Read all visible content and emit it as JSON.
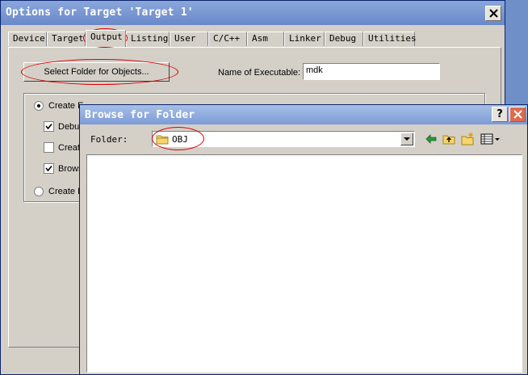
{
  "window": {
    "title": "Options for Target 'Target 1'",
    "tabs": [
      {
        "label": "Device"
      },
      {
        "label": "Target"
      },
      {
        "label": "Output"
      },
      {
        "label": "Listing"
      },
      {
        "label": "User"
      },
      {
        "label": "C/C++"
      },
      {
        "label": "Asm"
      },
      {
        "label": "Linker"
      },
      {
        "label": "Debug"
      },
      {
        "label": "Utilities"
      }
    ],
    "active_tab": "Output"
  },
  "output": {
    "select_folder_label": "Select Folder for Objects...",
    "name_label": "Name of Executable:",
    "name_value": "mdk",
    "options": {
      "create_exec_label": "Create E",
      "debug_label": "Debu",
      "create_hex_label": "Creat",
      "browse_label": "Brows",
      "create_lib_label": "Create L"
    }
  },
  "browse_dialog": {
    "title": "Browse for Folder",
    "help_label": "?",
    "folder_label": "Folder:",
    "folder_value": "OBJ"
  },
  "colors": {
    "annotation": "#d80000"
  }
}
